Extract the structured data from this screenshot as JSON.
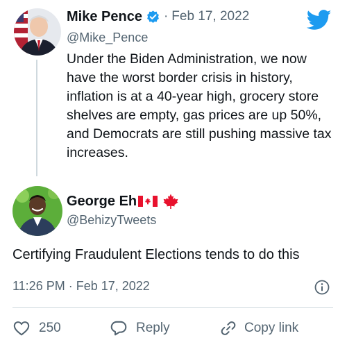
{
  "parent_tweet": {
    "author_name": "Mike Pence",
    "separator": "·",
    "date": "Feb 17, 2022",
    "handle": "@Mike_Pence",
    "text": "Under the Biden Administration, we now have the worst border crisis in history, inflation is at a 40-year high, grocery store shelves are empty, gas prices are up 50%, and Democrats are still pushing massive tax increases."
  },
  "reply_tweet": {
    "author_name": "George Eh",
    "handle": "@BehizyTweets",
    "text": "Certifying Fraudulent Elections tends to do this",
    "timestamp": "11:26 PM · Feb 17, 2022"
  },
  "actions": {
    "like_count": "250",
    "reply_label": "Reply",
    "copy_link_label": "Copy link"
  },
  "colors": {
    "twitter_blue": "#1d9bf0",
    "canada_red": "#e8112d",
    "secondary_text": "#536471",
    "primary_text": "#0f1419",
    "border": "#cfd9de"
  },
  "icons": [
    "verified-badge-icon",
    "twitter-bird-icon",
    "canada-flag-icon",
    "maple-leaf-icon",
    "info-icon",
    "heart-icon",
    "reply-bubble-icon",
    "link-icon"
  ]
}
